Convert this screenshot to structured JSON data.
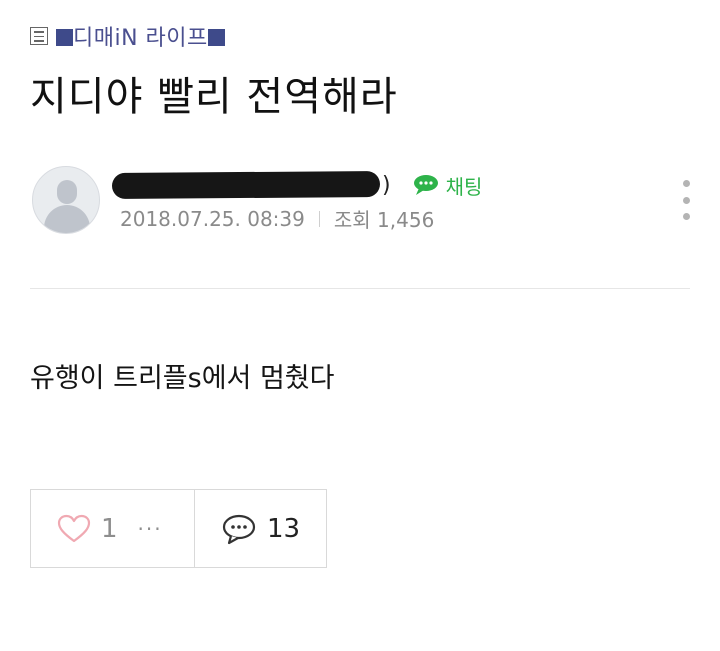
{
  "breadcrumb": {
    "label": "디매iN 라이프",
    "icon": "list-icon"
  },
  "post": {
    "title": "지디야 빨리 전역해라",
    "body": "유행이 트리플s에서 멈췄다"
  },
  "author": {
    "name_suffix": ")",
    "chat_label": "채팅",
    "date": "2018.07.25. 08:39",
    "views": "조회 1,456"
  },
  "actions": {
    "like_count": "1",
    "more_dots": "···",
    "comment_count": "13"
  },
  "colors": {
    "accent_green": "#2eb34a",
    "breadcrumb_blue": "#3e4a8a",
    "like_heart": "#f0a9b2"
  }
}
